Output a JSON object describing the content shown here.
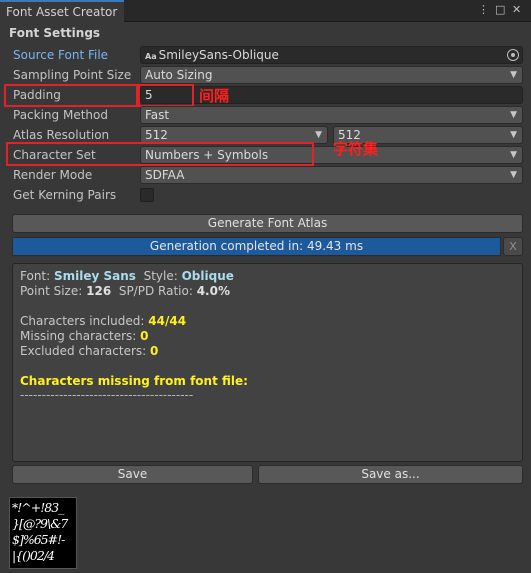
{
  "window": {
    "tab_title": "Font Asset Creator",
    "menu_icon": "kebab-menu-icon",
    "maximize_icon": "maximize-icon",
    "close_icon": "close-icon"
  },
  "section_title": "Font Settings",
  "fields": {
    "source_font": {
      "label": "Source Font File",
      "value": "SmileySans-Oblique",
      "icon_text": "Aa"
    },
    "sampling_point_size": {
      "label": "Sampling Point Size",
      "value": "Auto Sizing"
    },
    "padding": {
      "label": "Padding",
      "value": "5",
      "annotation": "间隔"
    },
    "packing_method": {
      "label": "Packing Method",
      "value": "Fast"
    },
    "atlas_resolution": {
      "label": "Atlas Resolution",
      "width": "512",
      "height": "512"
    },
    "character_set": {
      "label": "Character Set",
      "value": "Numbers + Symbols",
      "annotation": "字符集"
    },
    "render_mode": {
      "label": "Render Mode",
      "value": "SDFAA"
    },
    "kerning": {
      "label": "Get Kerning Pairs",
      "checked": false
    }
  },
  "buttons": {
    "generate": "Generate Font Atlas",
    "dismiss": "X",
    "save": "Save",
    "save_as": "Save as..."
  },
  "progress": {
    "text": "Generation completed in: 49.43 ms",
    "value": 1.0
  },
  "info": {
    "font_label": "Font:",
    "font_value": "Smiley Sans",
    "style_label": "Style:",
    "style_value": "Oblique",
    "point_size_label": "Point Size:",
    "point_size_value": "126",
    "ratio_label": "SP/PD Ratio:",
    "ratio_value": "4.0%",
    "included_label": "Characters included:",
    "included_value": "44/44",
    "missing_label": "Missing characters:",
    "missing_value": "0",
    "excluded_label": "Excluded characters:",
    "excluded_value": "0",
    "missing_header": "Characters missing from font file:",
    "separator": "----------------------------------------"
  },
  "atlas_preview": {
    "glyph_rows": [
      "*!^+!83_",
      "}[@?9\\&7",
      "$]%65#!-",
      "|{()02/4"
    ]
  },
  "colors": {
    "accent_blue": "#1d5a9c",
    "annotation_red": "#e0222a",
    "highlight_cyan": "#a9dcec",
    "highlight_yellow": "#fff01e"
  }
}
